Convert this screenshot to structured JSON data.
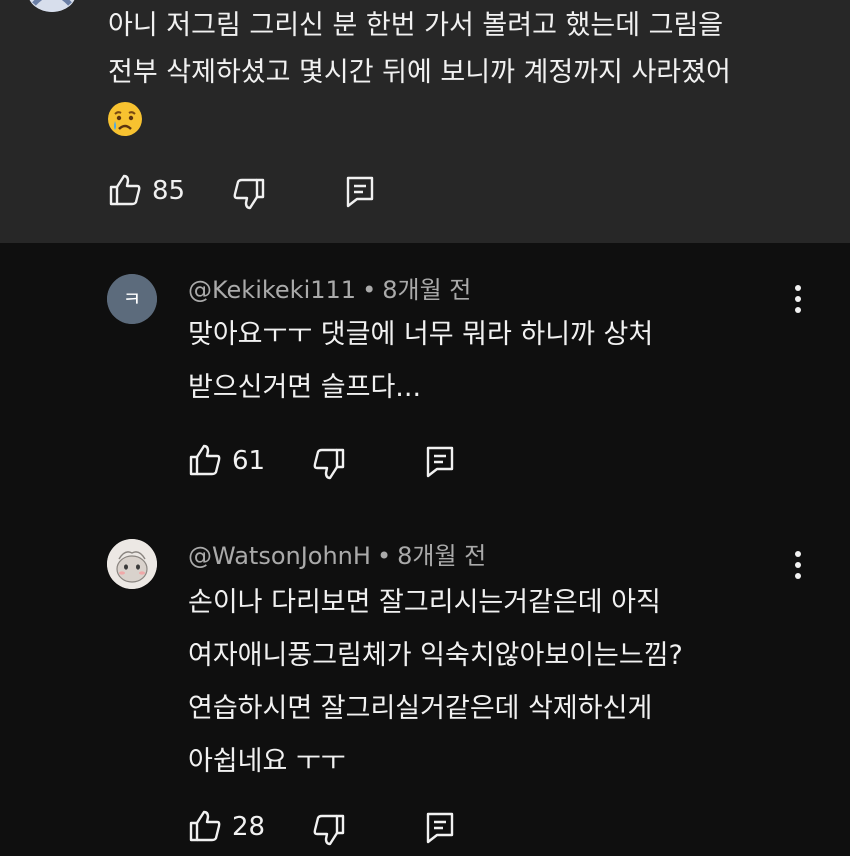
{
  "parent_comment": {
    "lines": [
      "아니 저그림 그리신 분 한번 가서 볼려고 했는데 그림을",
      "전부 삭제하셨고 몇시간 뒤에 보니까 계정까지 사라졌어"
    ],
    "emoji": "crying-face-emoji",
    "likes": "85"
  },
  "replies": [
    {
      "avatar_initial": "ㅋ",
      "avatar_color": "#5c6b7c",
      "handle": "@Kekikeki111",
      "separator": "•",
      "time": "8개월 전",
      "lines": [
        "맞아요ㅜㅜ 댓글에 너무 뭐라 하니까 상처",
        "받으신거면 슬프다..."
      ],
      "likes": "61"
    },
    {
      "avatar_image": "drawn-character-avatar",
      "handle": "@WatsonJohnH",
      "separator": "•",
      "time": "8개월 전",
      "lines": [
        "손이나 다리보면 잘그리시는거같은데 아직",
        "여자애니풍그림체가 익숙치않아보이는느낌?",
        "연습하시면 잘그리실거같은데 삭제하신게",
        "아쉽네요 ㅜㅜ"
      ],
      "likes": "28"
    }
  ],
  "icons": {
    "like": "thumbs-up-icon",
    "dislike": "thumbs-down-icon",
    "reply": "reply-comment-icon",
    "more": "more-vertical-icon"
  },
  "colors": {
    "background": "#0f0f0f",
    "highlight": "#272727",
    "text": "#f1f1f1",
    "meta": "#aaaaaa"
  }
}
